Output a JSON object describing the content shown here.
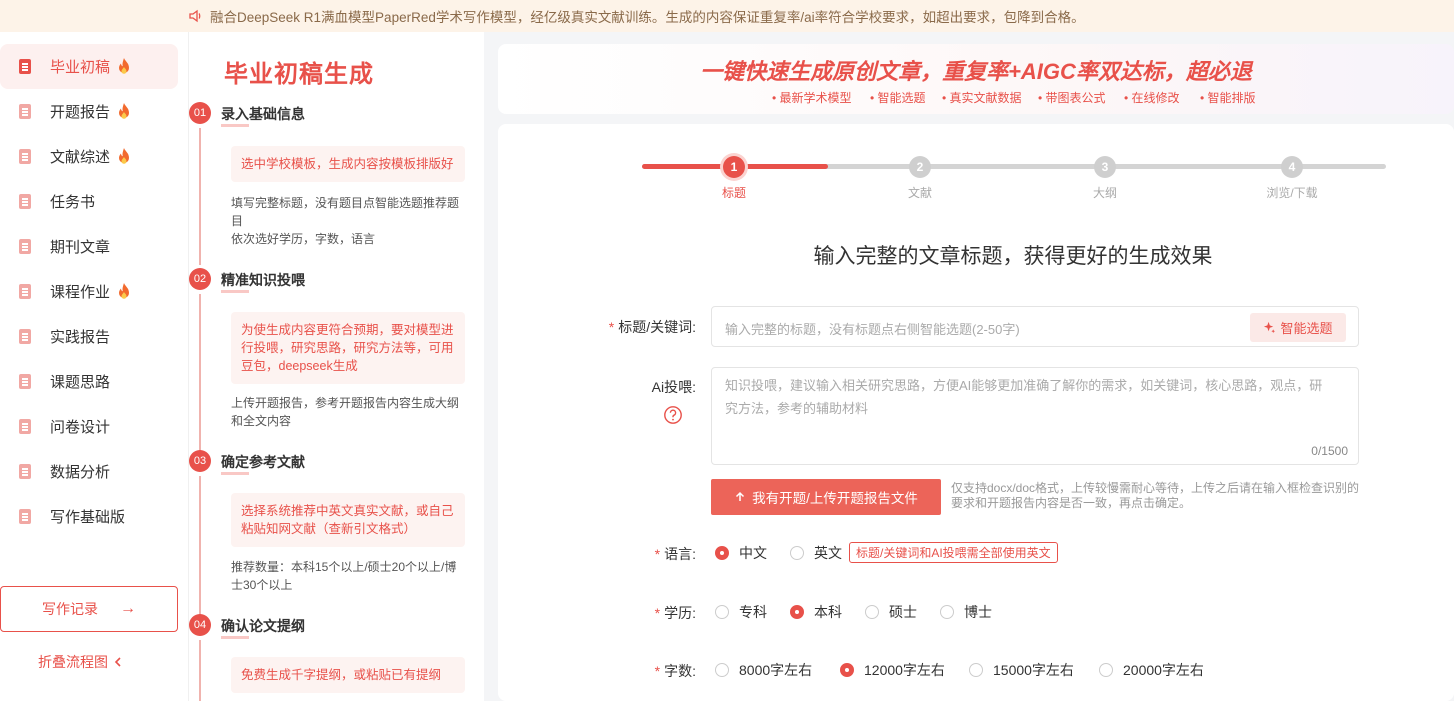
{
  "notice": {
    "text": "融合DeepSeek R1满血模型PaperRed学术写作模型，经亿级真实文献训练。生成的内容保证重复率/ai率符合学校要求，如超出要求，包降到合格。"
  },
  "sidebar": {
    "items": [
      {
        "label": "毕业初稿",
        "hot": true,
        "active": true
      },
      {
        "label": "开题报告",
        "hot": true
      },
      {
        "label": "文献综述",
        "hot": true
      },
      {
        "label": "任务书",
        "hot": false
      },
      {
        "label": "期刊文章",
        "hot": false
      },
      {
        "label": "课程作业",
        "hot": true
      },
      {
        "label": "实践报告",
        "hot": false
      },
      {
        "label": "课题思路",
        "hot": false
      },
      {
        "label": "问卷设计",
        "hot": false
      },
      {
        "label": "数据分析",
        "hot": false
      },
      {
        "label": "写作基础版",
        "hot": false
      }
    ],
    "record_label": "写作记录",
    "record_arrow": "→",
    "fold_label": "折叠流程图"
  },
  "flow": {
    "title": "毕业初稿生成",
    "steps": [
      {
        "num": "01",
        "title": "录入基础信息",
        "tip": "选中学校模板，生成内容按模板排版好",
        "desc": "填写完整标题，没有题目点智能选题推荐题目\n依次选好学历，字数，语言"
      },
      {
        "num": "02",
        "title": "精准知识投喂",
        "tip": "为使生成内容更符合预期，要对模型进行投喂，研究思路，研究方法等，可用豆包，deepseek生成",
        "desc": "上传开题报告，参考开题报告内容生成大纲和全文内容"
      },
      {
        "num": "03",
        "title": "确定参考文献",
        "tip": "选择系统推荐中英文真实文献，或自己粘贴知网文献（查新引文格式）",
        "desc": "推荐数量：本科15个以上/硕士20个以上/博士30个以上"
      },
      {
        "num": "04",
        "title": "确认论文提纲",
        "tip": "免费生成千字提纲，或粘贴已有提纲",
        "desc": ""
      }
    ]
  },
  "banner": {
    "title": "一键快速生成原创文章，重复率+AIGC率双达标，超必退",
    "features": [
      "最新学术模型",
      "智能选题",
      "真实文献数据",
      "带图表公式",
      "在线修改",
      "智能排版"
    ]
  },
  "stepper": {
    "steps": [
      {
        "num": "1",
        "label": "标题",
        "active": true
      },
      {
        "num": "2",
        "label": "文献",
        "active": false
      },
      {
        "num": "3",
        "label": "大纲",
        "active": false
      },
      {
        "num": "4",
        "label": "浏览/下载",
        "active": false
      }
    ]
  },
  "form": {
    "heading": "输入完整的文章标题，获得更好的生成效果",
    "title_label": "标题/关键词:",
    "title_placeholder": "输入完整的标题，没有标题点右侧智能选题(2-50字)",
    "smart_btn": "智能选题",
    "ai_label": "Ai投喂:",
    "ai_placeholder": "知识投喂，建议输入相关研究思路，方便AI能够更加准确了解你的需求，如关键词，核心思路，观点，研究方法，参考的辅助材料",
    "ai_count": "0/1500",
    "upload_btn": "我有开题/上传开题报告文件",
    "upload_note": "仅支持docx/doc格式，上传较慢需耐心等待，上传之后请在输入框检查识别的要求和开题报告内容是否一致，再点击确定。",
    "language": {
      "label": "语言:",
      "options": [
        "中文",
        "英文"
      ],
      "selected": 0,
      "tag": "标题/关键词和AI投喂需全部使用英文"
    },
    "degree": {
      "label": "学历:",
      "options": [
        "专科",
        "本科",
        "硕士",
        "博士"
      ],
      "selected": 1
    },
    "words": {
      "label": "字数:",
      "options": [
        "8000字左右",
        "12000字左右",
        "15000字左右",
        "20000字左右"
      ],
      "selected": 1
    }
  },
  "colors": {
    "accent": "#e8514a",
    "tip_bg": "#fdf3f1",
    "notice_bg": "#fdf3e8"
  }
}
